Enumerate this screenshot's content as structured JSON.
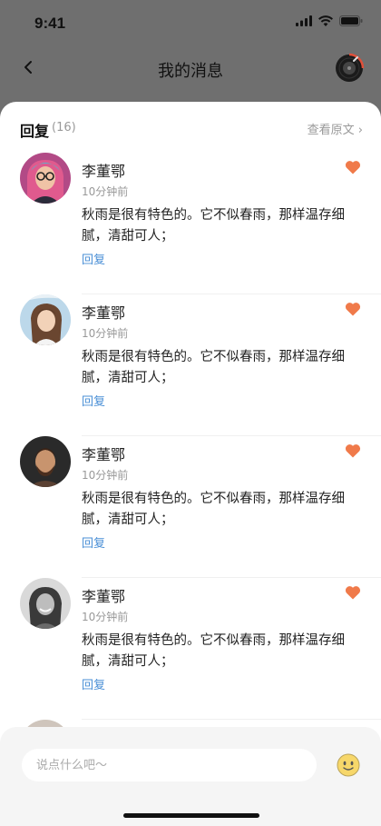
{
  "status_bar": {
    "time": "9:41"
  },
  "header": {
    "title": "我的消息"
  },
  "sheet": {
    "section_title": "回复",
    "count": "(16)",
    "view_original": "查看原文 ›"
  },
  "replies": [
    {
      "name": "李董鄂",
      "time": "10分钟前",
      "content": "秋雨是很有特色的。它不似春雨，那样温存细腻，清甜可人；",
      "reply_label": "回复"
    },
    {
      "name": "李董鄂",
      "time": "10分钟前",
      "content": "秋雨是很有特色的。它不似春雨，那样温存细腻，清甜可人；",
      "reply_label": "回复"
    },
    {
      "name": "李董鄂",
      "time": "10分钟前",
      "content": "秋雨是很有特色的。它不似春雨，那样温存细腻，清甜可人；",
      "reply_label": "回复"
    },
    {
      "name": "李董鄂",
      "time": "10分钟前",
      "content": "秋雨是很有特色的。它不似春雨，那样温存细腻，清甜可人；",
      "reply_label": "回复"
    }
  ],
  "input": {
    "placeholder": "说点什么吧～"
  },
  "colors": {
    "accent": "#4a8fd6",
    "like": "#f07a4a"
  }
}
